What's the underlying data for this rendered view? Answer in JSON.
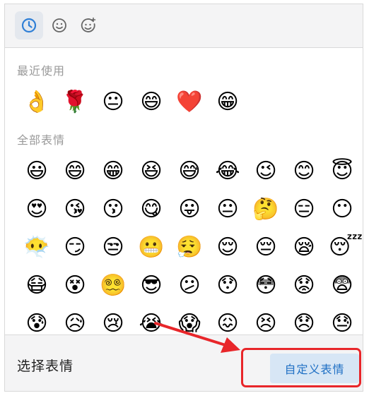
{
  "tabs": [
    {
      "icon": "clock-icon",
      "active": true
    },
    {
      "icon": "smiley-face-icon",
      "active": false
    },
    {
      "icon": "sticker-face-icon",
      "active": false
    }
  ],
  "recent": {
    "title": "最近使用",
    "emojis": [
      "👌",
      "🌹",
      "😐",
      "😄",
      "❤️",
      "😁"
    ]
  },
  "all": {
    "title": "全部表情",
    "emojis": [
      "😃",
      "😄",
      "😁",
      "😆",
      "😅",
      "😂",
      "😉",
      "😊",
      "😇",
      "😍",
      "😘",
      "😗",
      "😋",
      "😛",
      "😐",
      "🤔",
      "😑",
      "😶",
      "😶‍🌫️",
      "😏",
      "😒",
      "😬",
      "😮‍💨",
      "😌",
      "😔",
      "😪",
      "😴",
      "😷",
      "😵",
      "😵‍💫",
      "😎",
      "😕",
      "😯",
      "😳",
      "😟",
      "😨",
      "😰",
      "😥",
      "😢",
      "😭",
      "😱",
      "😖",
      "😣",
      "😞",
      "😓"
    ]
  },
  "footer": {
    "title": "选择表情",
    "custom_button": "自定义表情"
  },
  "colors": {
    "accent": "#1e6fc4",
    "highlight": "#e8262a"
  }
}
